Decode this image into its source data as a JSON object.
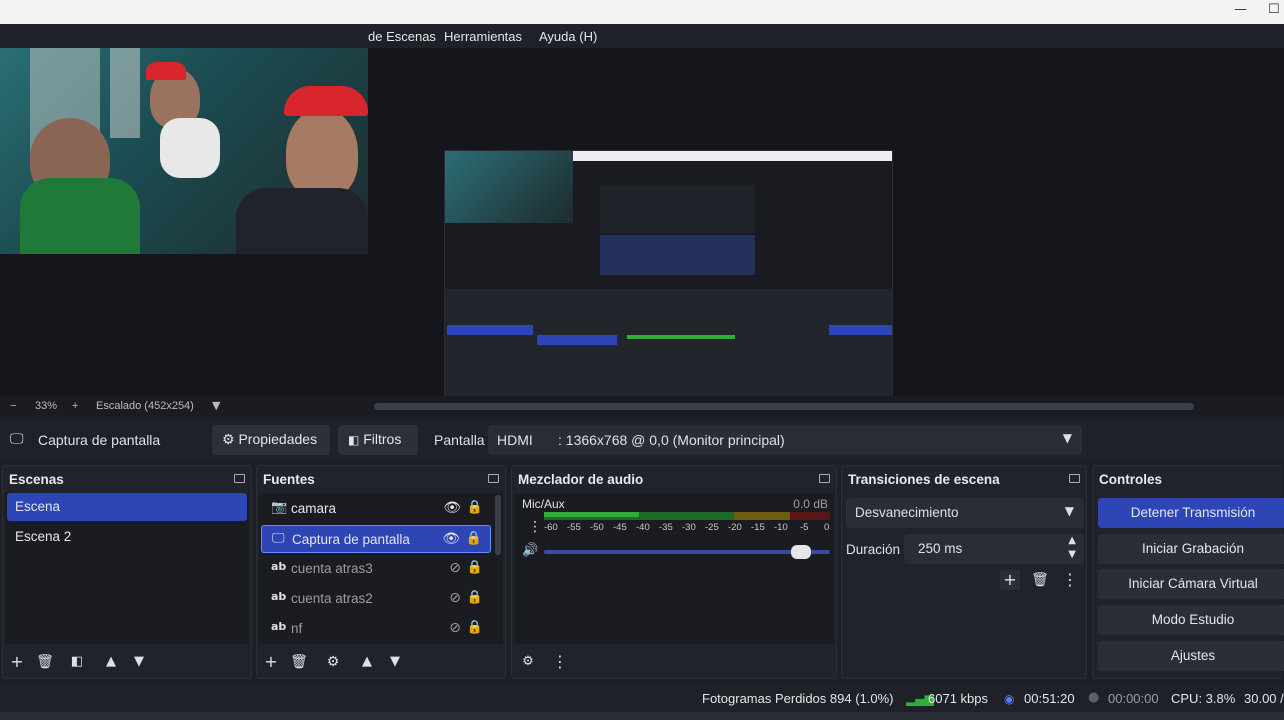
{
  "menu": {
    "items": [
      "de Escenas",
      "Herramientas",
      "Ayuda (H)"
    ]
  },
  "zoom": {
    "minus": "−",
    "level": "33%",
    "plus": "+",
    "scale_label": "Escalado (452x254)"
  },
  "source_toolbar": {
    "source_name": "Captura de pantalla",
    "properties_label": "Propiedades",
    "filters_label": "Filtros",
    "display_label": "Pantalla",
    "display_value_prefix": "HDMI",
    "display_value": ": 1366x768 @ 0,0 (Monitor principal)"
  },
  "scenes": {
    "title": "Escenas",
    "items": [
      "Escena",
      "Escena 2"
    ]
  },
  "sources": {
    "title": "Fuentes",
    "items": [
      {
        "name": "camara",
        "icon": "camera-icon",
        "visible": true
      },
      {
        "name": "Captura de pantalla",
        "icon": "monitor-icon",
        "visible": true
      },
      {
        "name": "cuenta atras3",
        "icon": "text-icon",
        "visible": false
      },
      {
        "name": "cuenta atras2",
        "icon": "text-icon",
        "visible": false
      },
      {
        "name": "nf",
        "icon": "text-icon",
        "visible": false
      }
    ]
  },
  "mixer": {
    "title": "Mezclador de audio",
    "channel": "Mic/Aux",
    "level": "0.0 dB",
    "volume": 0.93,
    "ticks": [
      "-60",
      "-55",
      "-50",
      "-45",
      "-40",
      "-35",
      "-30",
      "-25",
      "-20",
      "-15",
      "-10",
      "-5",
      "0"
    ]
  },
  "transitions": {
    "title": "Transiciones de escena",
    "selected": "Desvanecimiento",
    "duration_label": "Duración",
    "duration_value": "250 ms"
  },
  "controls": {
    "title": "Controles",
    "buttons": [
      "Detener Transmisión",
      "Iniciar Grabación",
      "Iniciar Cámara Virtual",
      "Modo Estudio",
      "Ajustes"
    ]
  },
  "status": {
    "dropped_frames": "Fotogramas Perdidos 894 (1.0%)",
    "bitrate": "6071 kbps",
    "stream_time": "00:51:20",
    "record_time": "00:00:00",
    "cpu": "CPU: 3.8%",
    "fps": "30.00 /"
  },
  "colors": {
    "accent": "#2d45b5",
    "panel": "#21232b",
    "meter_green": "#2fae3a",
    "meter_yellow": "#b8a21c",
    "meter_red": "#9c2424"
  }
}
